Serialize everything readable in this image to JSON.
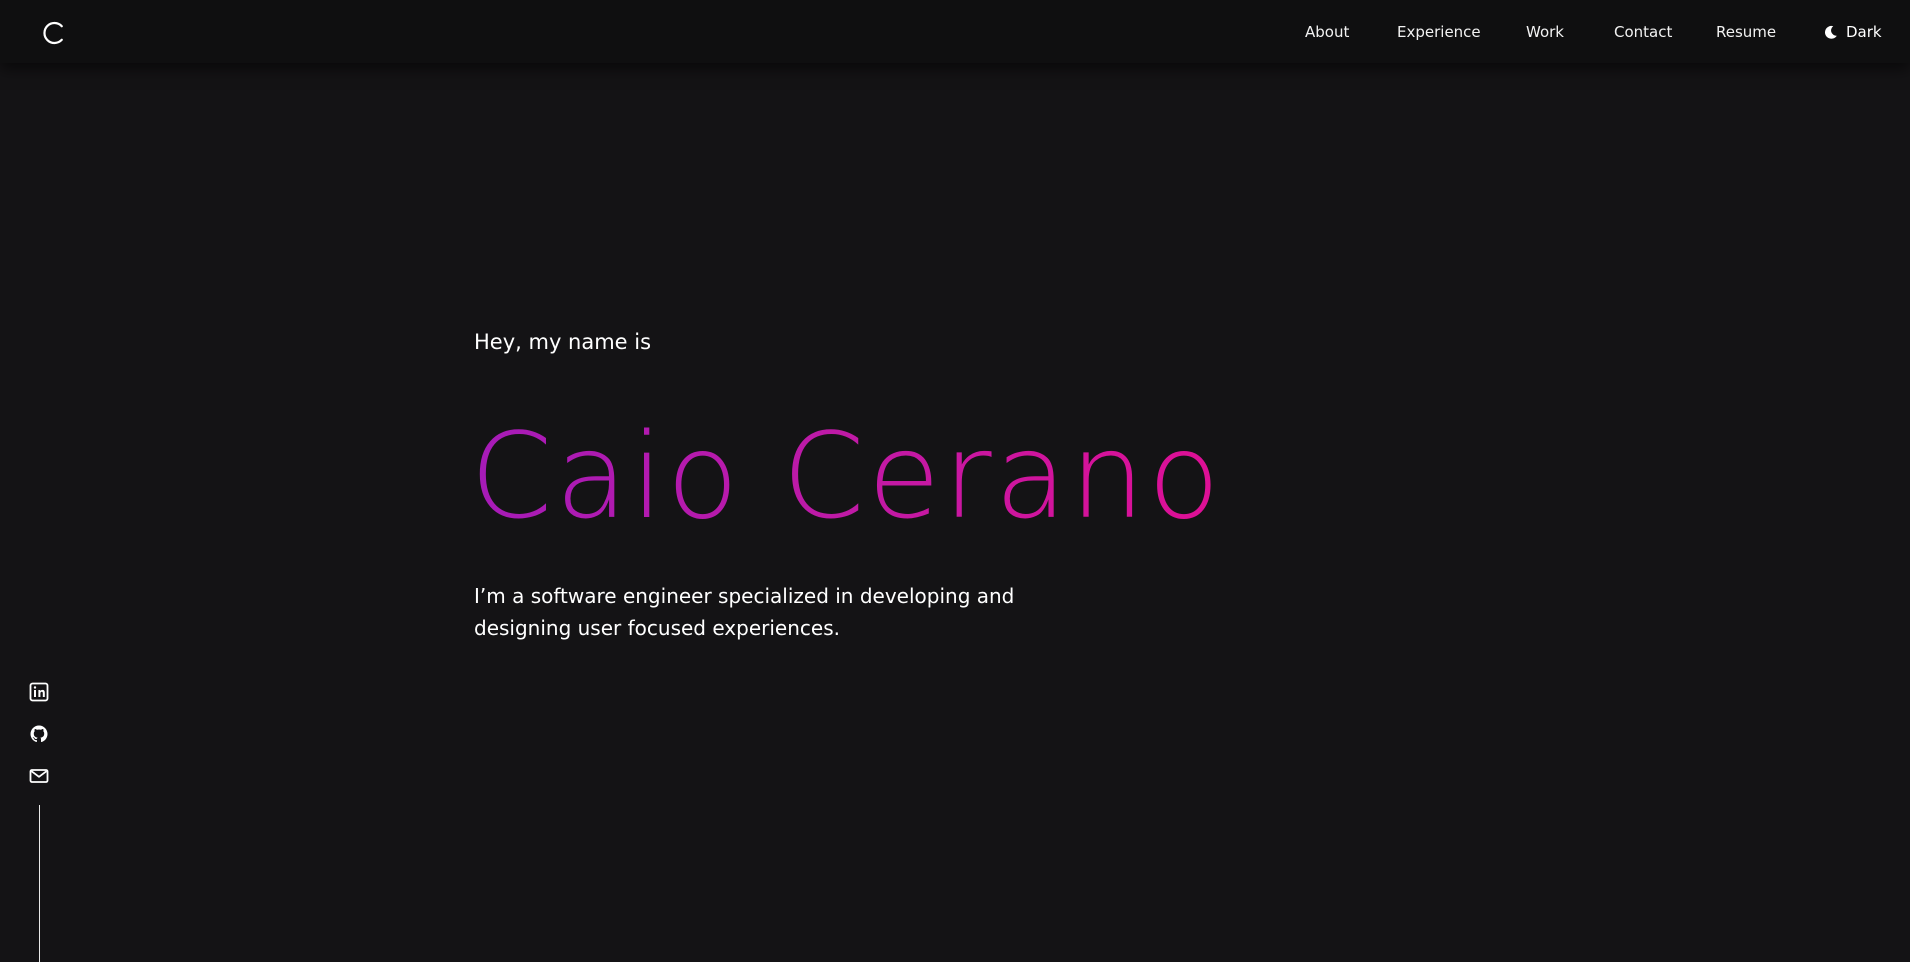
{
  "header": {
    "logo_icon": "logo-c-icon",
    "nav": [
      {
        "label": "About"
      },
      {
        "label": "Experience"
      },
      {
        "label": "Work"
      },
      {
        "label": "Contact"
      },
      {
        "label": "Resume"
      }
    ],
    "theme_toggle": {
      "icon": "moon-icon",
      "label": "Dark"
    }
  },
  "hero": {
    "greeting": "Hey, my name is",
    "name": "Caio Cerano",
    "intro": "I’m a software engineer specialized in developing and designing user focused experiences."
  },
  "social": {
    "items": [
      {
        "icon": "linkedin-icon"
      },
      {
        "icon": "github-icon"
      },
      {
        "icon": "mail-icon"
      }
    ]
  },
  "colors": {
    "background": "#141315",
    "header_background": "#0f0f10",
    "text": "#ffffff",
    "name_gradient_start": "#a61bb8",
    "name_gradient_end": "#df0f95"
  }
}
